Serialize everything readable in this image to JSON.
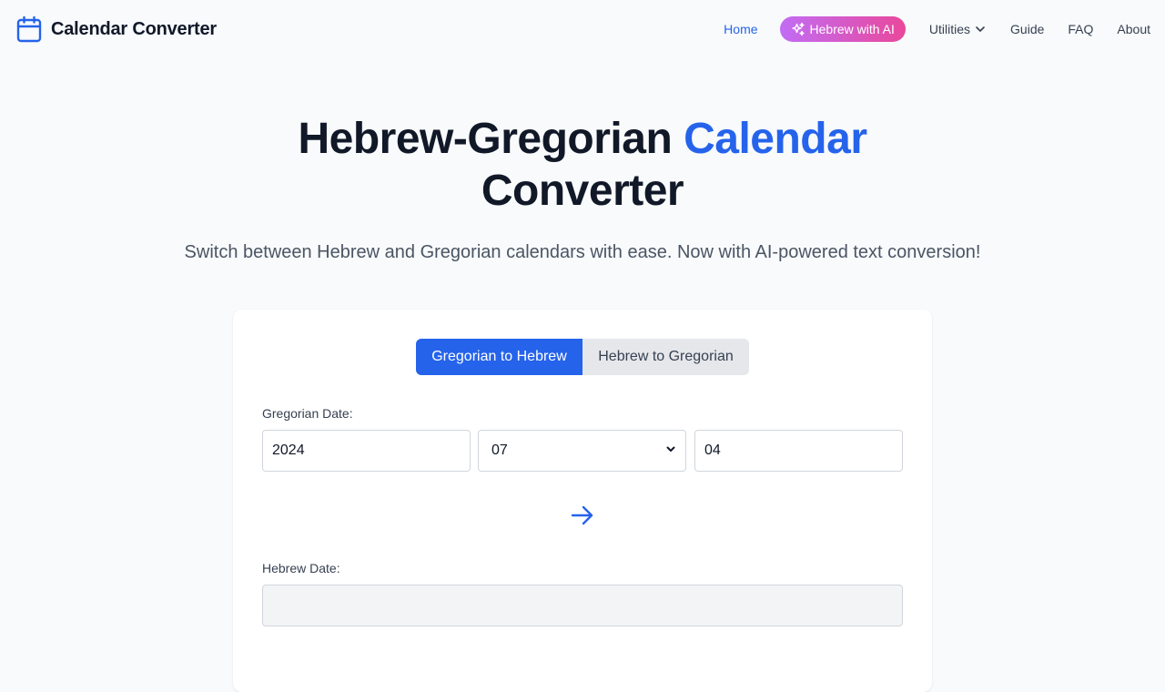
{
  "brand": {
    "name": "Calendar Converter",
    "icon": "calendar-icon"
  },
  "nav": {
    "home": "Home",
    "ai": "Hebrew with AI",
    "utilities": "Utilities",
    "guide": "Guide",
    "faq": "FAQ",
    "about": "About"
  },
  "hero": {
    "title_part1": "Hebrew-Gregorian ",
    "title_accent": "Calendar",
    "title_part2": "Converter",
    "subtitle": "Switch between Hebrew and Gregorian calendars with ease. Now with AI-powered text conversion!"
  },
  "converter": {
    "tab_active": "Gregorian to Hebrew",
    "tab_inactive": "Hebrew to Gregorian",
    "gregorian_label": "Gregorian Date:",
    "year": "2024",
    "month": "07",
    "day": "04",
    "hebrew_label": "Hebrew Date:",
    "hebrew_value": ""
  },
  "colors": {
    "accent": "#2563eb",
    "ai_gradient_start": "#c26cf4",
    "ai_gradient_end": "#e9489b",
    "background": "#f8fafc"
  }
}
